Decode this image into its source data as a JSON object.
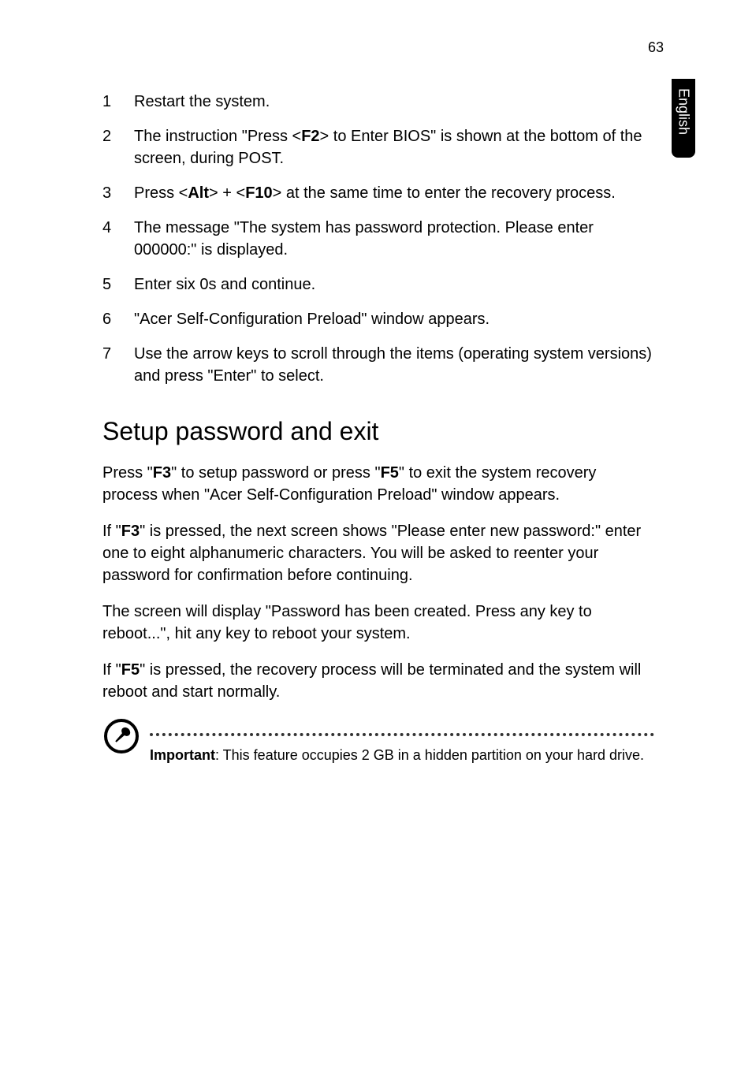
{
  "page_number": "63",
  "side_tab": "English",
  "list": {
    "items": [
      {
        "num": "1",
        "text_parts": [
          [
            "",
            "Restart the system."
          ]
        ]
      },
      {
        "num": "2",
        "text_parts": [
          [
            "",
            "The instruction \"Press <"
          ],
          [
            "b",
            "F2"
          ],
          [
            "",
            "> to Enter BIOS\" is shown at the bottom of the screen, during POST."
          ]
        ]
      },
      {
        "num": "3",
        "text_parts": [
          [
            "",
            "Press <"
          ],
          [
            "b",
            "Alt"
          ],
          [
            "",
            "> + <"
          ],
          [
            "b",
            "F10"
          ],
          [
            "",
            "> at the same time to enter the recovery process."
          ]
        ]
      },
      {
        "num": "4",
        "text_parts": [
          [
            "",
            "The message \"The system has password protection. Please enter 000000:\" is displayed."
          ]
        ]
      },
      {
        "num": "5",
        "text_parts": [
          [
            "",
            "Enter six 0s and continue."
          ]
        ]
      },
      {
        "num": "6",
        "text_parts": [
          [
            "",
            "\"Acer Self-Configuration Preload\" window appears."
          ]
        ]
      },
      {
        "num": "7",
        "text_parts": [
          [
            "",
            "Use the arrow keys to scroll through the items (operating system versions) and press \"Enter\" to select."
          ]
        ]
      }
    ]
  },
  "heading": "Setup password and exit",
  "paragraphs": [
    [
      [
        "",
        "Press \""
      ],
      [
        "b",
        "F3"
      ],
      [
        "",
        "\" to setup password or press \""
      ],
      [
        "b",
        "F5"
      ],
      [
        "",
        "\" to exit the system recovery process when \"Acer Self-Configuration Preload\" window appears."
      ]
    ],
    [
      [
        "",
        "If \""
      ],
      [
        "b",
        "F3"
      ],
      [
        "",
        "\" is pressed, the next screen shows \"Please enter new password:\" enter one to eight alphanumeric characters. You will be asked to reenter your password for confirmation before continuing."
      ]
    ],
    [
      [
        "",
        "The screen will display \"Password has been created. Press any key to reboot...\", hit any key to reboot your system."
      ]
    ],
    [
      [
        "",
        "If \""
      ],
      [
        "b",
        "F5"
      ],
      [
        "",
        "\" is pressed, the recovery process will be terminated and the system will reboot and start normally."
      ]
    ]
  ],
  "callout": {
    "label_bold": "Important",
    "label_rest": ": This feature occupies 2 GB in a hidden partition on your hard drive."
  }
}
